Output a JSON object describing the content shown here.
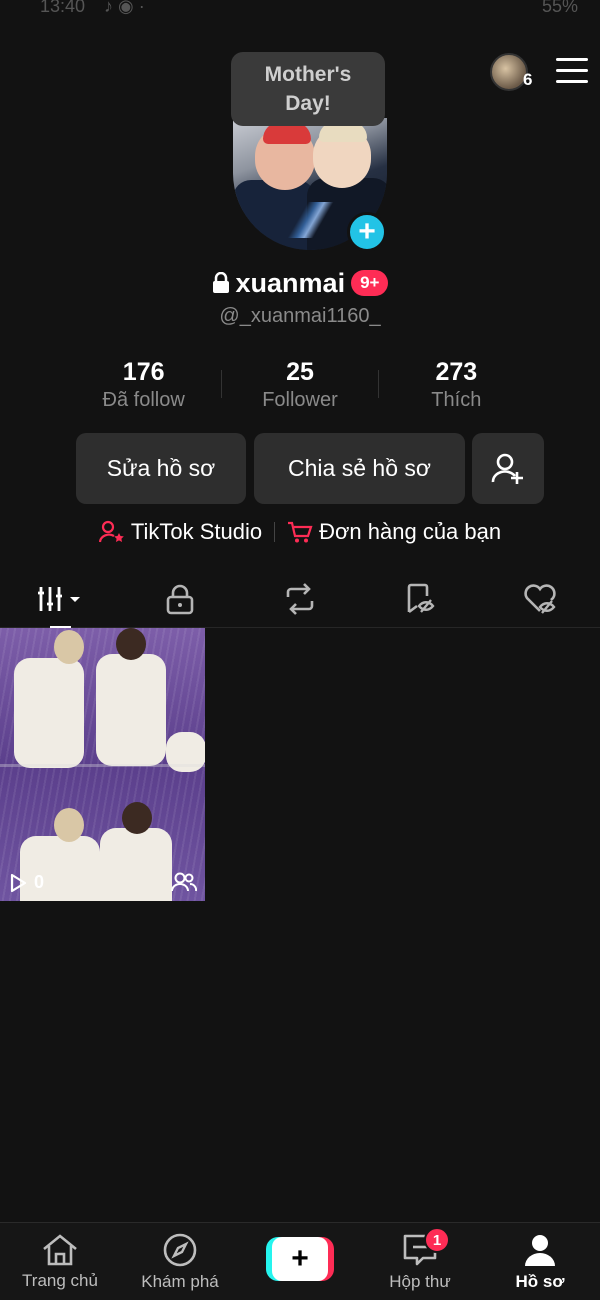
{
  "status_bar": {
    "time": "13:40",
    "battery": "55%"
  },
  "header": {
    "account_switch_count": "6"
  },
  "tooltip": {
    "text": "Mother's Day!"
  },
  "profile": {
    "username": "xuanmai",
    "badge": "9+",
    "handle": "@_xuanmai1160_"
  },
  "stats": {
    "following": {
      "value": "176",
      "label": "Đã follow"
    },
    "followers": {
      "value": "25",
      "label": "Follower"
    },
    "likes": {
      "value": "273",
      "label": "Thích"
    }
  },
  "actions": {
    "edit_profile": "Sửa hồ sơ",
    "share_profile": "Chia sẻ hồ sơ"
  },
  "links": {
    "studio": "TikTok Studio",
    "orders": "Đơn hàng của bạn"
  },
  "tabs": [
    "videos-grid",
    "private",
    "reposts",
    "favorites",
    "liked"
  ],
  "videos": [
    {
      "views": "0"
    }
  ],
  "bottom_nav": {
    "home": "Trang chủ",
    "discover": "Khám phá",
    "inbox": "Hộp thư",
    "inbox_badge": "1",
    "profile": "Hồ sơ"
  },
  "colors": {
    "accent": "#fe2c55",
    "cyan": "#25f4ee",
    "add_button": "#22c3e6",
    "background": "#121212"
  }
}
